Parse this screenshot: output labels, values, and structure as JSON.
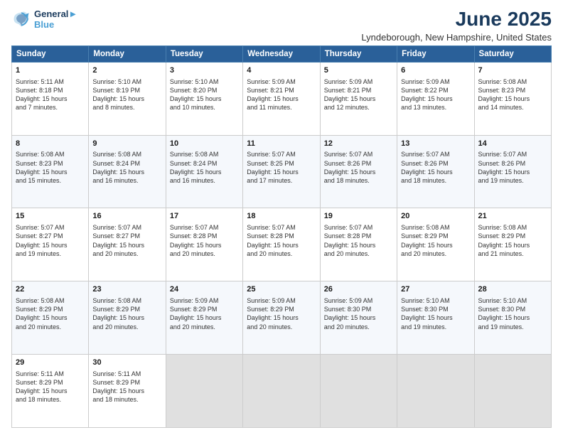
{
  "logo": {
    "line1": "General",
    "line2": "Blue",
    "icon_color": "#4a9fd4"
  },
  "title": "June 2025",
  "subtitle": "Lyndeborough, New Hampshire, United States",
  "days_header": [
    "Sunday",
    "Monday",
    "Tuesday",
    "Wednesday",
    "Thursday",
    "Friday",
    "Saturday"
  ],
  "weeks": [
    [
      {
        "day": 1,
        "lines": [
          "Sunrise: 5:11 AM",
          "Sunset: 8:18 PM",
          "Daylight: 15 hours",
          "and 7 minutes."
        ]
      },
      {
        "day": 2,
        "lines": [
          "Sunrise: 5:10 AM",
          "Sunset: 8:19 PM",
          "Daylight: 15 hours",
          "and 8 minutes."
        ]
      },
      {
        "day": 3,
        "lines": [
          "Sunrise: 5:10 AM",
          "Sunset: 8:20 PM",
          "Daylight: 15 hours",
          "and 10 minutes."
        ]
      },
      {
        "day": 4,
        "lines": [
          "Sunrise: 5:09 AM",
          "Sunset: 8:21 PM",
          "Daylight: 15 hours",
          "and 11 minutes."
        ]
      },
      {
        "day": 5,
        "lines": [
          "Sunrise: 5:09 AM",
          "Sunset: 8:21 PM",
          "Daylight: 15 hours",
          "and 12 minutes."
        ]
      },
      {
        "day": 6,
        "lines": [
          "Sunrise: 5:09 AM",
          "Sunset: 8:22 PM",
          "Daylight: 15 hours",
          "and 13 minutes."
        ]
      },
      {
        "day": 7,
        "lines": [
          "Sunrise: 5:08 AM",
          "Sunset: 8:23 PM",
          "Daylight: 15 hours",
          "and 14 minutes."
        ]
      }
    ],
    [
      {
        "day": 8,
        "lines": [
          "Sunrise: 5:08 AM",
          "Sunset: 8:23 PM",
          "Daylight: 15 hours",
          "and 15 minutes."
        ]
      },
      {
        "day": 9,
        "lines": [
          "Sunrise: 5:08 AM",
          "Sunset: 8:24 PM",
          "Daylight: 15 hours",
          "and 16 minutes."
        ]
      },
      {
        "day": 10,
        "lines": [
          "Sunrise: 5:08 AM",
          "Sunset: 8:24 PM",
          "Daylight: 15 hours",
          "and 16 minutes."
        ]
      },
      {
        "day": 11,
        "lines": [
          "Sunrise: 5:07 AM",
          "Sunset: 8:25 PM",
          "Daylight: 15 hours",
          "and 17 minutes."
        ]
      },
      {
        "day": 12,
        "lines": [
          "Sunrise: 5:07 AM",
          "Sunset: 8:26 PM",
          "Daylight: 15 hours",
          "and 18 minutes."
        ]
      },
      {
        "day": 13,
        "lines": [
          "Sunrise: 5:07 AM",
          "Sunset: 8:26 PM",
          "Daylight: 15 hours",
          "and 18 minutes."
        ]
      },
      {
        "day": 14,
        "lines": [
          "Sunrise: 5:07 AM",
          "Sunset: 8:26 PM",
          "Daylight: 15 hours",
          "and 19 minutes."
        ]
      }
    ],
    [
      {
        "day": 15,
        "lines": [
          "Sunrise: 5:07 AM",
          "Sunset: 8:27 PM",
          "Daylight: 15 hours",
          "and 19 minutes."
        ]
      },
      {
        "day": 16,
        "lines": [
          "Sunrise: 5:07 AM",
          "Sunset: 8:27 PM",
          "Daylight: 15 hours",
          "and 20 minutes."
        ]
      },
      {
        "day": 17,
        "lines": [
          "Sunrise: 5:07 AM",
          "Sunset: 8:28 PM",
          "Daylight: 15 hours",
          "and 20 minutes."
        ]
      },
      {
        "day": 18,
        "lines": [
          "Sunrise: 5:07 AM",
          "Sunset: 8:28 PM",
          "Daylight: 15 hours",
          "and 20 minutes."
        ]
      },
      {
        "day": 19,
        "lines": [
          "Sunrise: 5:07 AM",
          "Sunset: 8:28 PM",
          "Daylight: 15 hours",
          "and 20 minutes."
        ]
      },
      {
        "day": 20,
        "lines": [
          "Sunrise: 5:08 AM",
          "Sunset: 8:29 PM",
          "Daylight: 15 hours",
          "and 20 minutes."
        ]
      },
      {
        "day": 21,
        "lines": [
          "Sunrise: 5:08 AM",
          "Sunset: 8:29 PM",
          "Daylight: 15 hours",
          "and 21 minutes."
        ]
      }
    ],
    [
      {
        "day": 22,
        "lines": [
          "Sunrise: 5:08 AM",
          "Sunset: 8:29 PM",
          "Daylight: 15 hours",
          "and 20 minutes."
        ]
      },
      {
        "day": 23,
        "lines": [
          "Sunrise: 5:08 AM",
          "Sunset: 8:29 PM",
          "Daylight: 15 hours",
          "and 20 minutes."
        ]
      },
      {
        "day": 24,
        "lines": [
          "Sunrise: 5:09 AM",
          "Sunset: 8:29 PM",
          "Daylight: 15 hours",
          "and 20 minutes."
        ]
      },
      {
        "day": 25,
        "lines": [
          "Sunrise: 5:09 AM",
          "Sunset: 8:29 PM",
          "Daylight: 15 hours",
          "and 20 minutes."
        ]
      },
      {
        "day": 26,
        "lines": [
          "Sunrise: 5:09 AM",
          "Sunset: 8:30 PM",
          "Daylight: 15 hours",
          "and 20 minutes."
        ]
      },
      {
        "day": 27,
        "lines": [
          "Sunrise: 5:10 AM",
          "Sunset: 8:30 PM",
          "Daylight: 15 hours",
          "and 19 minutes."
        ]
      },
      {
        "day": 28,
        "lines": [
          "Sunrise: 5:10 AM",
          "Sunset: 8:30 PM",
          "Daylight: 15 hours",
          "and 19 minutes."
        ]
      }
    ],
    [
      {
        "day": 29,
        "lines": [
          "Sunrise: 5:11 AM",
          "Sunset: 8:29 PM",
          "Daylight: 15 hours",
          "and 18 minutes."
        ]
      },
      {
        "day": 30,
        "lines": [
          "Sunrise: 5:11 AM",
          "Sunset: 8:29 PM",
          "Daylight: 15 hours",
          "and 18 minutes."
        ]
      },
      {
        "day": null,
        "lines": []
      },
      {
        "day": null,
        "lines": []
      },
      {
        "day": null,
        "lines": []
      },
      {
        "day": null,
        "lines": []
      },
      {
        "day": null,
        "lines": []
      }
    ]
  ]
}
